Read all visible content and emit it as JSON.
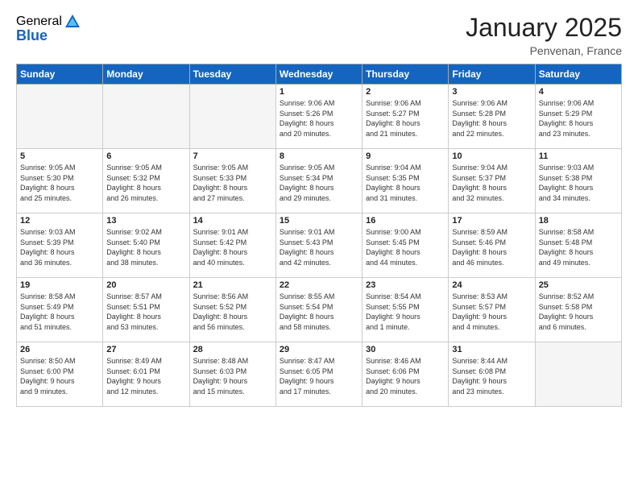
{
  "header": {
    "logo_general": "General",
    "logo_blue": "Blue",
    "month_title": "January 2025",
    "location": "Penvenan, France"
  },
  "weekdays": [
    "Sunday",
    "Monday",
    "Tuesday",
    "Wednesday",
    "Thursday",
    "Friday",
    "Saturday"
  ],
  "weeks": [
    [
      {
        "day": "",
        "content": ""
      },
      {
        "day": "",
        "content": ""
      },
      {
        "day": "",
        "content": ""
      },
      {
        "day": "1",
        "content": "Sunrise: 9:06 AM\nSunset: 5:26 PM\nDaylight: 8 hours\nand 20 minutes."
      },
      {
        "day": "2",
        "content": "Sunrise: 9:06 AM\nSunset: 5:27 PM\nDaylight: 8 hours\nand 21 minutes."
      },
      {
        "day": "3",
        "content": "Sunrise: 9:06 AM\nSunset: 5:28 PM\nDaylight: 8 hours\nand 22 minutes."
      },
      {
        "day": "4",
        "content": "Sunrise: 9:06 AM\nSunset: 5:29 PM\nDaylight: 8 hours\nand 23 minutes."
      }
    ],
    [
      {
        "day": "5",
        "content": "Sunrise: 9:05 AM\nSunset: 5:30 PM\nDaylight: 8 hours\nand 25 minutes."
      },
      {
        "day": "6",
        "content": "Sunrise: 9:05 AM\nSunset: 5:32 PM\nDaylight: 8 hours\nand 26 minutes."
      },
      {
        "day": "7",
        "content": "Sunrise: 9:05 AM\nSunset: 5:33 PM\nDaylight: 8 hours\nand 27 minutes."
      },
      {
        "day": "8",
        "content": "Sunrise: 9:05 AM\nSunset: 5:34 PM\nDaylight: 8 hours\nand 29 minutes."
      },
      {
        "day": "9",
        "content": "Sunrise: 9:04 AM\nSunset: 5:35 PM\nDaylight: 8 hours\nand 31 minutes."
      },
      {
        "day": "10",
        "content": "Sunrise: 9:04 AM\nSunset: 5:37 PM\nDaylight: 8 hours\nand 32 minutes."
      },
      {
        "day": "11",
        "content": "Sunrise: 9:03 AM\nSunset: 5:38 PM\nDaylight: 8 hours\nand 34 minutes."
      }
    ],
    [
      {
        "day": "12",
        "content": "Sunrise: 9:03 AM\nSunset: 5:39 PM\nDaylight: 8 hours\nand 36 minutes."
      },
      {
        "day": "13",
        "content": "Sunrise: 9:02 AM\nSunset: 5:40 PM\nDaylight: 8 hours\nand 38 minutes."
      },
      {
        "day": "14",
        "content": "Sunrise: 9:01 AM\nSunset: 5:42 PM\nDaylight: 8 hours\nand 40 minutes."
      },
      {
        "day": "15",
        "content": "Sunrise: 9:01 AM\nSunset: 5:43 PM\nDaylight: 8 hours\nand 42 minutes."
      },
      {
        "day": "16",
        "content": "Sunrise: 9:00 AM\nSunset: 5:45 PM\nDaylight: 8 hours\nand 44 minutes."
      },
      {
        "day": "17",
        "content": "Sunrise: 8:59 AM\nSunset: 5:46 PM\nDaylight: 8 hours\nand 46 minutes."
      },
      {
        "day": "18",
        "content": "Sunrise: 8:58 AM\nSunset: 5:48 PM\nDaylight: 8 hours\nand 49 minutes."
      }
    ],
    [
      {
        "day": "19",
        "content": "Sunrise: 8:58 AM\nSunset: 5:49 PM\nDaylight: 8 hours\nand 51 minutes."
      },
      {
        "day": "20",
        "content": "Sunrise: 8:57 AM\nSunset: 5:51 PM\nDaylight: 8 hours\nand 53 minutes."
      },
      {
        "day": "21",
        "content": "Sunrise: 8:56 AM\nSunset: 5:52 PM\nDaylight: 8 hours\nand 56 minutes."
      },
      {
        "day": "22",
        "content": "Sunrise: 8:55 AM\nSunset: 5:54 PM\nDaylight: 8 hours\nand 58 minutes."
      },
      {
        "day": "23",
        "content": "Sunrise: 8:54 AM\nSunset: 5:55 PM\nDaylight: 9 hours\nand 1 minute."
      },
      {
        "day": "24",
        "content": "Sunrise: 8:53 AM\nSunset: 5:57 PM\nDaylight: 9 hours\nand 4 minutes."
      },
      {
        "day": "25",
        "content": "Sunrise: 8:52 AM\nSunset: 5:58 PM\nDaylight: 9 hours\nand 6 minutes."
      }
    ],
    [
      {
        "day": "26",
        "content": "Sunrise: 8:50 AM\nSunset: 6:00 PM\nDaylight: 9 hours\nand 9 minutes."
      },
      {
        "day": "27",
        "content": "Sunrise: 8:49 AM\nSunset: 6:01 PM\nDaylight: 9 hours\nand 12 minutes."
      },
      {
        "day": "28",
        "content": "Sunrise: 8:48 AM\nSunset: 6:03 PM\nDaylight: 9 hours\nand 15 minutes."
      },
      {
        "day": "29",
        "content": "Sunrise: 8:47 AM\nSunset: 6:05 PM\nDaylight: 9 hours\nand 17 minutes."
      },
      {
        "day": "30",
        "content": "Sunrise: 8:46 AM\nSunset: 6:06 PM\nDaylight: 9 hours\nand 20 minutes."
      },
      {
        "day": "31",
        "content": "Sunrise: 8:44 AM\nSunset: 6:08 PM\nDaylight: 9 hours\nand 23 minutes."
      },
      {
        "day": "",
        "content": ""
      }
    ]
  ]
}
